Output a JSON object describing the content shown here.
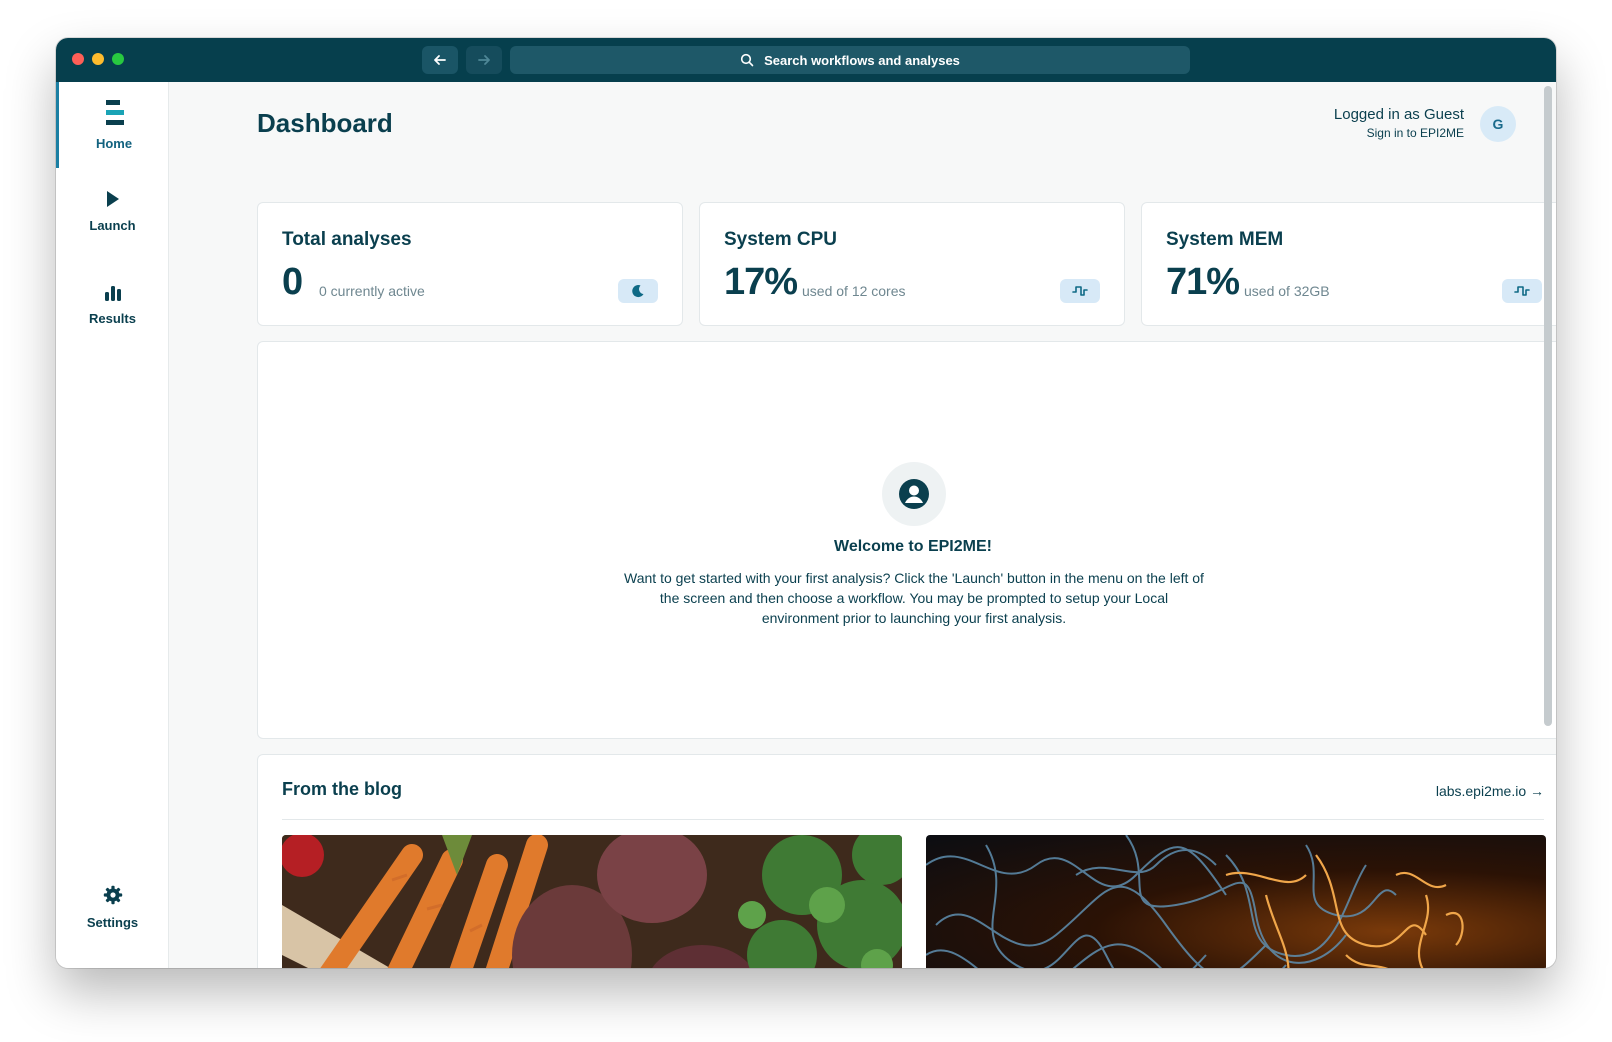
{
  "titlebar": {
    "search_placeholder": "Search workflows and analyses"
  },
  "sidebar": {
    "items": [
      {
        "label": "Home",
        "icon": "epi2me-logo-icon",
        "active": true
      },
      {
        "label": "Launch",
        "icon": "play-icon",
        "active": false
      },
      {
        "label": "Results",
        "icon": "bar-chart-icon",
        "active": false
      }
    ],
    "settings_label": "Settings"
  },
  "header": {
    "title": "Dashboard",
    "user_status": "Logged in as Guest",
    "sign_in_link": "Sign in to EPI2ME",
    "avatar_initial": "G"
  },
  "stats": [
    {
      "title": "Total analyses",
      "value": "0",
      "sub": "0 currently active",
      "icon": "moon-icon"
    },
    {
      "title": "System CPU",
      "value": "17%",
      "sub": "used of 12 cores",
      "icon": "pulse-icon"
    },
    {
      "title": "System MEM",
      "value": "71%",
      "sub": "used of 32GB",
      "icon": "pulse-icon"
    }
  ],
  "welcome": {
    "title": "Welcome to EPI2ME!",
    "text": "Want to get started with your first analysis? Click the 'Launch' button in the menu on the left of the screen and then choose a workflow. You may be prompted to setup your Local environment prior to launching your first analysis."
  },
  "blog": {
    "title": "From the blog",
    "link": "labs.epi2me.io →"
  },
  "colors": {
    "titlebar": "#063f4d",
    "text_primary": "#0a3f4e",
    "accent": "#1b7fa3",
    "badge_bg": "#d7e9f7"
  }
}
